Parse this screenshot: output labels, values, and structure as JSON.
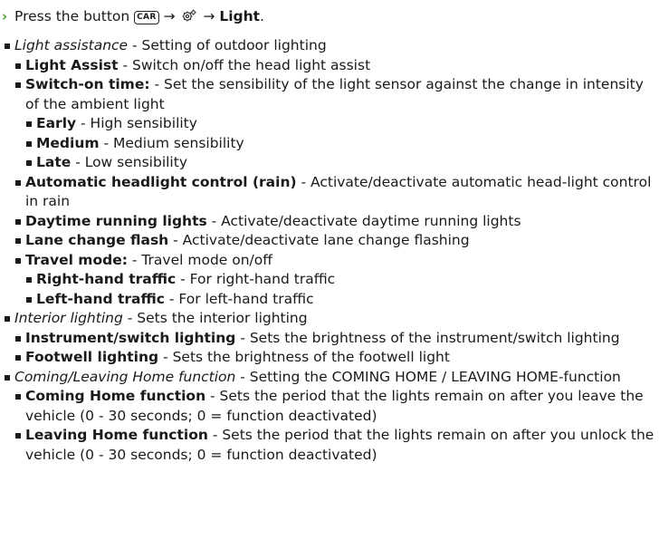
{
  "instruction": {
    "press": "Press the button",
    "car_key": "CAR",
    "arrow_sep": "→",
    "target": "Light",
    "end": "."
  },
  "icons": {
    "lead": "chevron-right-icon",
    "car": "car-button-icon",
    "settings": "settings-gear-icon"
  },
  "items": {
    "light_assistance": {
      "title": "Light assistance",
      "desc": " - Setting of outdoor lighting"
    },
    "light_assist": {
      "title": "Light Assist",
      "desc": " - Switch on/off the head light assist"
    },
    "switch_on_time": {
      "title": "Switch-on time:",
      "desc": " - Set the sensibility of the light sensor against the change in intensity of the ambient light"
    },
    "early": {
      "title": "Early",
      "desc": " - High sensibility"
    },
    "medium": {
      "title": "Medium",
      "desc": " - Medium sensibility"
    },
    "late": {
      "title": "Late",
      "desc": " - Low sensibility"
    },
    "auto_headlight": {
      "title": "Automatic headlight control (rain)",
      "desc": " - Activate/deactivate automatic head-light control in rain"
    },
    "daytime": {
      "title": "Daytime running lights",
      "desc": " - Activate/deactivate daytime running lights"
    },
    "lane_change": {
      "title": "Lane change flash",
      "desc": " - Activate/deactivate lane change flashing"
    },
    "travel_mode": {
      "title": "Travel mode:",
      "desc": " - Travel mode on/off"
    },
    "right_hand": {
      "title": "Right-hand traffic",
      "desc": " - For right-hand traffic"
    },
    "left_hand": {
      "title": "Left-hand traffic",
      "desc": " - For left-hand traffic"
    },
    "interior": {
      "title": "Interior lighting",
      "desc": " - Sets the interior lighting"
    },
    "instrument": {
      "title": "Instrument/switch lighting",
      "desc": " - Sets the brightness of the instrument/switch lighting"
    },
    "footwell": {
      "title": "Footwell lighting",
      "desc": " - Sets the brightness of the footwell light"
    },
    "coming_leaving": {
      "title": "Coming/Leaving Home function",
      "desc": " - Setting the COMING HOME / LEAVING HOME-function"
    },
    "coming_home": {
      "title": "Coming Home function",
      "desc": " - Sets the period that the lights remain on after you leave the vehicle (0 - 30 seconds; 0 = function deactivated)"
    },
    "leaving_home": {
      "title": "Leaving Home function",
      "desc": " - Sets the period that the lights remain on after you unlock the vehicle (0 - 30 seconds; 0 = function deactivated)"
    }
  }
}
